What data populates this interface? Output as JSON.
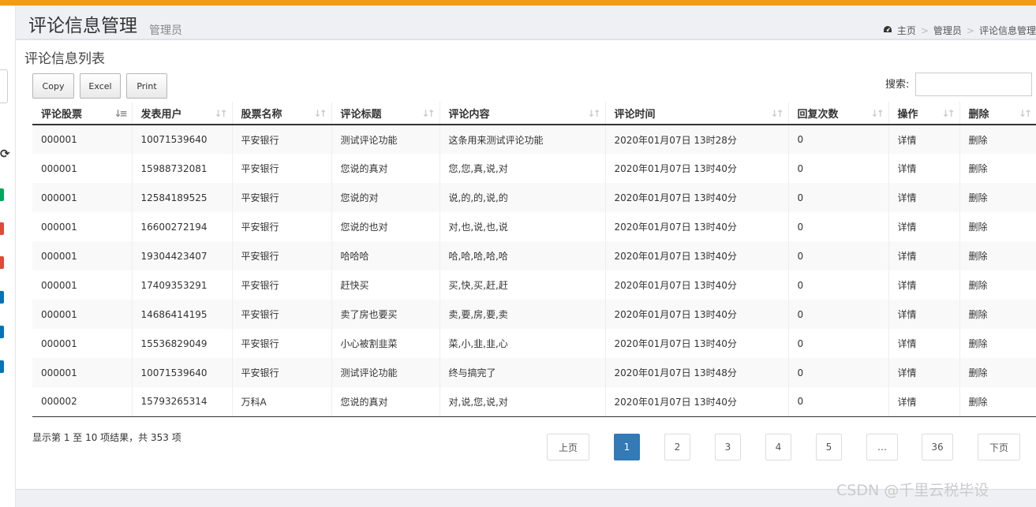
{
  "colors": {
    "accent": "#f39c12",
    "link": "#337ab7",
    "delete": "#d9534f",
    "active_page": "#337ab7"
  },
  "header": {
    "title": "评论信息管理",
    "subtitle": "管理员",
    "breadcrumb": {
      "home_icon": "dashboard-icon",
      "home": "主页",
      "level1": "管理员",
      "level2": "评论信息管理"
    }
  },
  "sidebar": {
    "refresh_icon": "refresh-icon",
    "badges": [
      "#00a65a",
      "#dd4b39",
      "#dd4b39",
      "#0073b7",
      "#0073b7",
      "#0073b7"
    ]
  },
  "main": {
    "section_title": "评论信息列表",
    "buttons": {
      "copy": "Copy",
      "excel": "Excel",
      "print": "Print"
    },
    "search_label": "搜索:",
    "search_value": ""
  },
  "table": {
    "headers": [
      "评论股票",
      "发表用户",
      "股票名称",
      "评论标题",
      "评论内容",
      "评论时间",
      "回复次数",
      "操作",
      "删除"
    ],
    "sorted_column": 0,
    "rows": [
      [
        "000001",
        "10071539640",
        "平安银行",
        "测试评论功能",
        "这条用来测试评论功能",
        "2020年01月07日 13时28分",
        "0",
        "详情",
        "删除"
      ],
      [
        "000001",
        "15988732081",
        "平安银行",
        "您说的真对",
        "您,您,真,说,对",
        "2020年01月07日 13时40分",
        "0",
        "详情",
        "删除"
      ],
      [
        "000001",
        "12584189525",
        "平安银行",
        "您说的对",
        "说,的,的,说,的",
        "2020年01月07日 13时40分",
        "0",
        "详情",
        "删除"
      ],
      [
        "000001",
        "16600272194",
        "平安银行",
        "您说的也对",
        "对,也,说,也,说",
        "2020年01月07日 13时40分",
        "0",
        "详情",
        "删除"
      ],
      [
        "000001",
        "19304423407",
        "平安银行",
        "哈哈哈",
        "哈,哈,哈,哈,哈",
        "2020年01月07日 13时40分",
        "0",
        "详情",
        "删除"
      ],
      [
        "000001",
        "17409353291",
        "平安银行",
        "赶快买",
        "买,快,买,赶,赶",
        "2020年01月07日 13时40分",
        "0",
        "详情",
        "删除"
      ],
      [
        "000001",
        "14686414195",
        "平安银行",
        "卖了房也要买",
        "卖,要,房,要,卖",
        "2020年01月07日 13时40分",
        "0",
        "详情",
        "删除"
      ],
      [
        "000001",
        "15536829049",
        "平安银行",
        "小心被割韭菜",
        "菜,小,韭,韭,心",
        "2020年01月07日 13时40分",
        "0",
        "详情",
        "删除"
      ],
      [
        "000001",
        "10071539640",
        "平安银行",
        "测试评论功能",
        "终与搞完了",
        "2020年01月07日 13时48分",
        "0",
        "详情",
        "删除"
      ],
      [
        "000002",
        "15793265314",
        "万科A",
        "您说的真对",
        "对,说,您,说,对",
        "2020年01月07日 13时40分",
        "0",
        "详情",
        "删除"
      ]
    ]
  },
  "footer": {
    "info": "显示第 1 至 10 项结果，共 353 项",
    "pagination": {
      "prev": "上页",
      "pages": [
        "1",
        "2",
        "3",
        "4",
        "5",
        "…",
        "36"
      ],
      "current": "1",
      "next": "下页"
    }
  },
  "watermark": "CSDN @千里云税毕设"
}
